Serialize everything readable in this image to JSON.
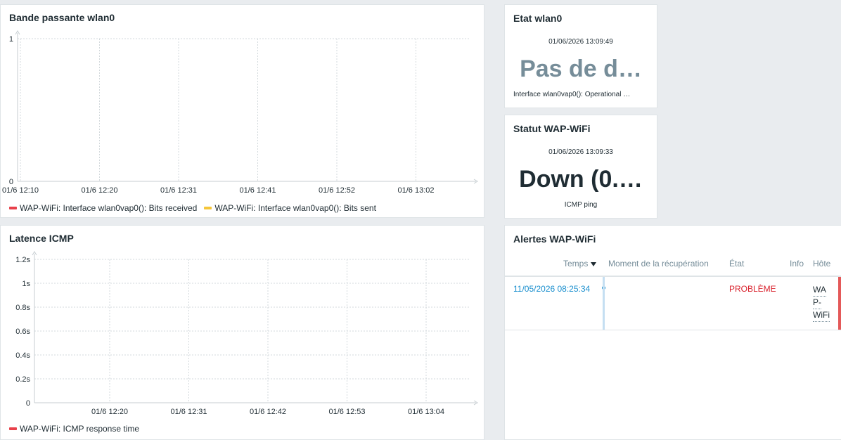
{
  "bandwidth": {
    "title": "Bande passante wlan0",
    "y_ticks": [
      "1",
      "0"
    ],
    "x_ticks": [
      "01/6 12:10",
      "01/6 12:20",
      "01/6 12:31",
      "01/6 12:41",
      "01/6 12:52",
      "01/6 13:02"
    ],
    "legend": [
      {
        "label": "WAP-WiFi: Interface wlan0vap0(): Bits received",
        "color": "#e8414b"
      },
      {
        "label": "WAP-WiFi: Interface wlan0vap0(): Bits sent",
        "color": "#f5c63a"
      }
    ]
  },
  "latency": {
    "title": "Latence ICMP",
    "y_ticks": [
      "1.2s",
      "1s",
      "0.8s",
      "0.6s",
      "0.4s",
      "0.2s",
      "0"
    ],
    "x_ticks": [
      "01/6 12:20",
      "01/6 12:31",
      "01/6 12:42",
      "01/6 12:53",
      "01/6 13:04"
    ],
    "legend": [
      {
        "label": "WAP-WiFi: ICMP response time",
        "color": "#e8414b"
      }
    ]
  },
  "etat_wlan0": {
    "title": "Etat wlan0",
    "time": "01/06/2026 13:09:49",
    "value": "Pas de d…",
    "value_color": "#768d99",
    "description": "Interface wlan0vap0(): Operational …"
  },
  "statut_wifi": {
    "title": "Statut WAP-WiFi",
    "time": "01/06/2026 13:09:33",
    "value": "Down (0.…",
    "value_color": "#1f2c33",
    "description": "ICMP ping"
  },
  "alerts": {
    "title": "Alertes WAP-WiFi",
    "columns": {
      "time": "Temps",
      "recovery": "Moment de la récupération",
      "status": "État",
      "info": "Info",
      "host": "Hôte"
    },
    "rows": [
      {
        "time": "11/05/2026 08:25:34",
        "recovery": "",
        "status": "PROBLÈME",
        "status_color": "#d9212c",
        "host_lines": [
          "WA",
          "P-",
          "WiFi"
        ],
        "severity_color": "#e45959"
      }
    ]
  },
  "chart_data": [
    {
      "type": "line",
      "title": "Bande passante wlan0",
      "x": [
        "01/6 12:10",
        "01/6 12:20",
        "01/6 12:31",
        "01/6 12:41",
        "01/6 12:52",
        "01/6 13:02"
      ],
      "ylim": [
        0,
        1
      ],
      "grid": true,
      "legend": "bottom",
      "series": [
        {
          "name": "WAP-WiFi: Interface wlan0vap0(): Bits received",
          "values": []
        },
        {
          "name": "WAP-WiFi: Interface wlan0vap0(): Bits sent",
          "values": []
        }
      ]
    },
    {
      "type": "line",
      "title": "Latence ICMP",
      "x": [
        "01/6 12:20",
        "01/6 12:31",
        "01/6 12:42",
        "01/6 12:53",
        "01/6 13:04"
      ],
      "ylim": [
        0,
        1.2
      ],
      "grid": true,
      "legend": "bottom",
      "series": [
        {
          "name": "WAP-WiFi: ICMP response time",
          "values": []
        }
      ]
    }
  ]
}
